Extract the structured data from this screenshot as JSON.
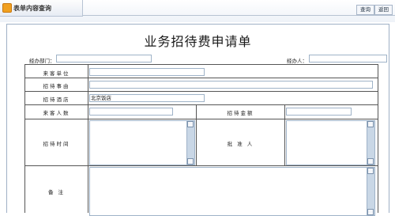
{
  "header": {
    "tab_title": "表单内容查询",
    "query_button": "查询",
    "back_button": "返回"
  },
  "form": {
    "title": "业务招待费申请单",
    "department_label": "经办部门：",
    "handler_label": "经办人：",
    "rows": {
      "visitor_unit": "来客单位",
      "reason": "招待事由",
      "hotel": "招待酒店",
      "hotel_value": "北京饭店",
      "visitor_count": "来客人数",
      "amount": "招待金额",
      "time": "招待时间",
      "approver": "批 准 人",
      "remarks": "备  注"
    }
  }
}
